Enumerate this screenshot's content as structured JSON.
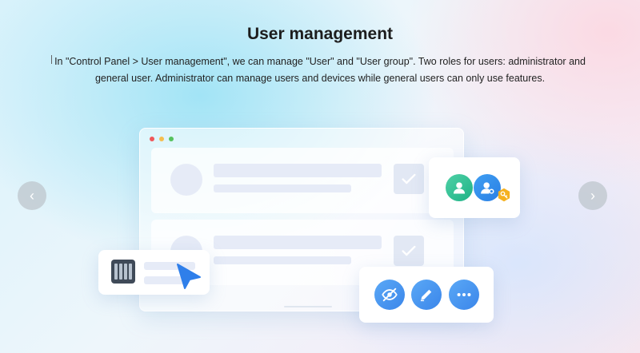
{
  "header": {
    "title": "User management",
    "description": "In \"Control Panel > User management\", we can manage \"User\" and \"User group\". Two roles for users: administrator and general user. Administrator can manage users and devices while general users can only use features."
  },
  "carousel": {
    "prev_glyph": "‹",
    "next_glyph": "›"
  },
  "icons": {
    "prev": "chevron-left-icon",
    "next": "chevron-right-icon",
    "user_role": "user-icon",
    "admin_role": "admin-user-icon",
    "key": "key-icon",
    "device": "nas-device-icon",
    "pointer": "cursor-pointer-icon",
    "hide": "eye-off-icon",
    "edit": "pencil-icon",
    "more": "more-horizontal-icon",
    "check": "checkmark-icon"
  },
  "colors": {
    "accent_blue": "#3b86ea",
    "user_green": "#1fb286",
    "key_orange": "#f5b120",
    "window_red": "#f0575a",
    "window_yellow": "#f5be4f",
    "window_green": "#56c25e"
  }
}
